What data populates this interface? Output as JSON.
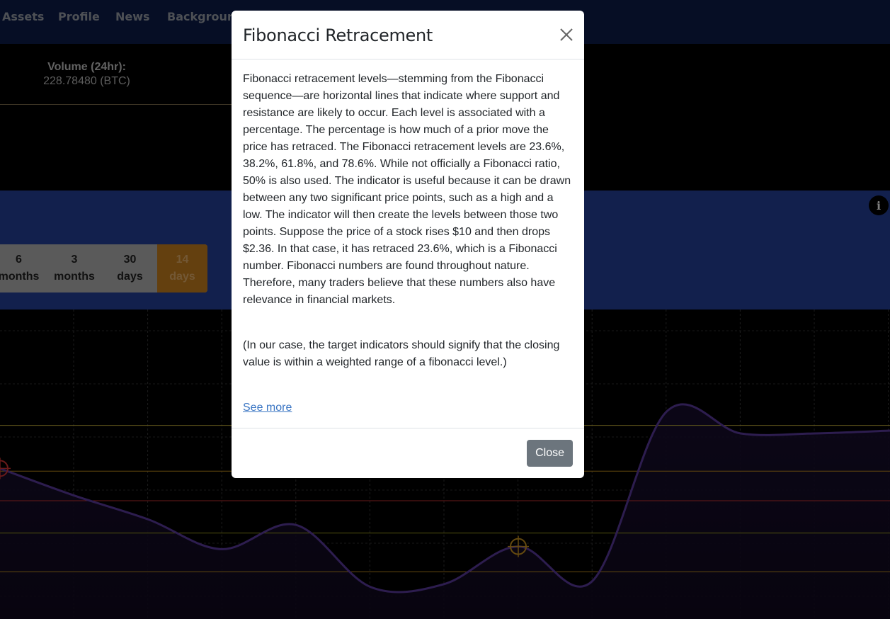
{
  "nav": {
    "items": [
      "Assets",
      "Profile",
      "News",
      "Background"
    ]
  },
  "stats": {
    "volume_label": "Volume (24hr):",
    "volume_value": "228.78480 (BTC)"
  },
  "range": {
    "buttons": [
      {
        "top": "6",
        "bottom": "months"
      },
      {
        "top": "3",
        "bottom": "months"
      },
      {
        "top": "30",
        "bottom": "days"
      },
      {
        "top": "14",
        "bottom": "days"
      }
    ],
    "active": "14 days"
  },
  "info_icon": "info-icon",
  "chart_data": {
    "type": "line",
    "series": [
      {
        "values": [
          0.62,
          0.52,
          0.43,
          0.32,
          0.41,
          0.18,
          0.19,
          0.33,
          0.2,
          0.83,
          0.75,
          0.75
        ]
      }
    ],
    "fib_levels": [
      0.78,
      0.61,
      0.5,
      0.38,
      0.236
    ],
    "level_colors": [
      "#c9b53a",
      "#c8931f",
      "#d13434",
      "#a6a61e",
      "#c8931f"
    ],
    "line_color": "#5b3a9e",
    "grid": true,
    "markers": [
      {
        "at_point": 0,
        "color": "#d13434"
      },
      {
        "at_point": 7,
        "color": "#c8931f"
      }
    ]
  },
  "modal": {
    "title": "Fibonacci Retracement",
    "body_p1": "Fibonacci retracement levels—stemming from the Fibonacci sequence—are horizontal lines that indicate where support and resistance are likely to occur. Each level is associated with a percentage. The percentage is how much of a prior move the price has retraced. The Fibonacci retracement levels are 23.6%, 38.2%, 61.8%, and 78.6%. While not officially a Fibonacci ratio, 50% is also used. The indicator is useful because it can be drawn between any two significant price points, such as a high and a low. The indicator will then create the levels between those two points. Suppose the price of a stock rises $10 and then drops $2.36. In that case, it has retraced 23.6%, which is a Fibonacci number. Fibonacci numbers are found throughout nature. Therefore, many traders believe that these numbers also have relevance in financial markets.",
    "body_p2": "(In our case, the target indicators should signify that the closing value is within a weighted range of a fibonacci level.)",
    "see_more": "See more",
    "close_label": "Close",
    "close_icon": "close-icon"
  }
}
